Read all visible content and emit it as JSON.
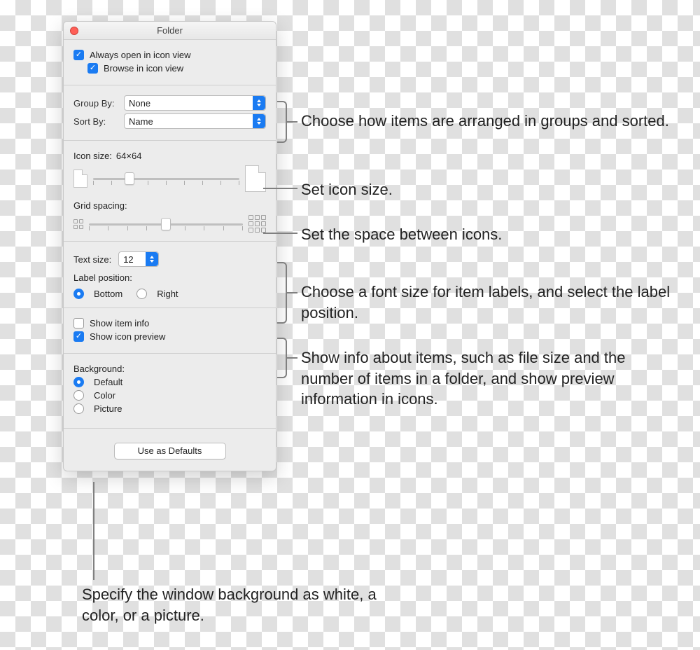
{
  "title": "Folder",
  "checkboxes": {
    "always_open": "Always open in icon view",
    "browse": "Browse in icon view",
    "show_item_info": "Show item info",
    "show_icon_preview": "Show icon preview"
  },
  "group_sort": {
    "group_by_label": "Group By:",
    "group_by_value": "None",
    "sort_by_label": "Sort By:",
    "sort_by_value": "Name"
  },
  "icon_size": {
    "label": "Icon size:",
    "value": "64×64"
  },
  "grid_spacing_label": "Grid spacing:",
  "text_size": {
    "label": "Text size:",
    "value": "12"
  },
  "label_position": {
    "label": "Label position:",
    "bottom": "Bottom",
    "right": "Right"
  },
  "background": {
    "label": "Background:",
    "default": "Default",
    "color": "Color",
    "picture": "Picture"
  },
  "use_defaults": "Use as Defaults",
  "annotations": {
    "a1": "Choose how items are arranged in groups and sorted.",
    "a2": "Set icon size.",
    "a3": "Set the space between icons.",
    "a4": "Choose a font size for item labels, and select the label position.",
    "a5": "Show info about items, such as file size and the number of items in a folder, and show preview information in icons.",
    "a6": "Specify the window background as white, a color, or a picture."
  }
}
